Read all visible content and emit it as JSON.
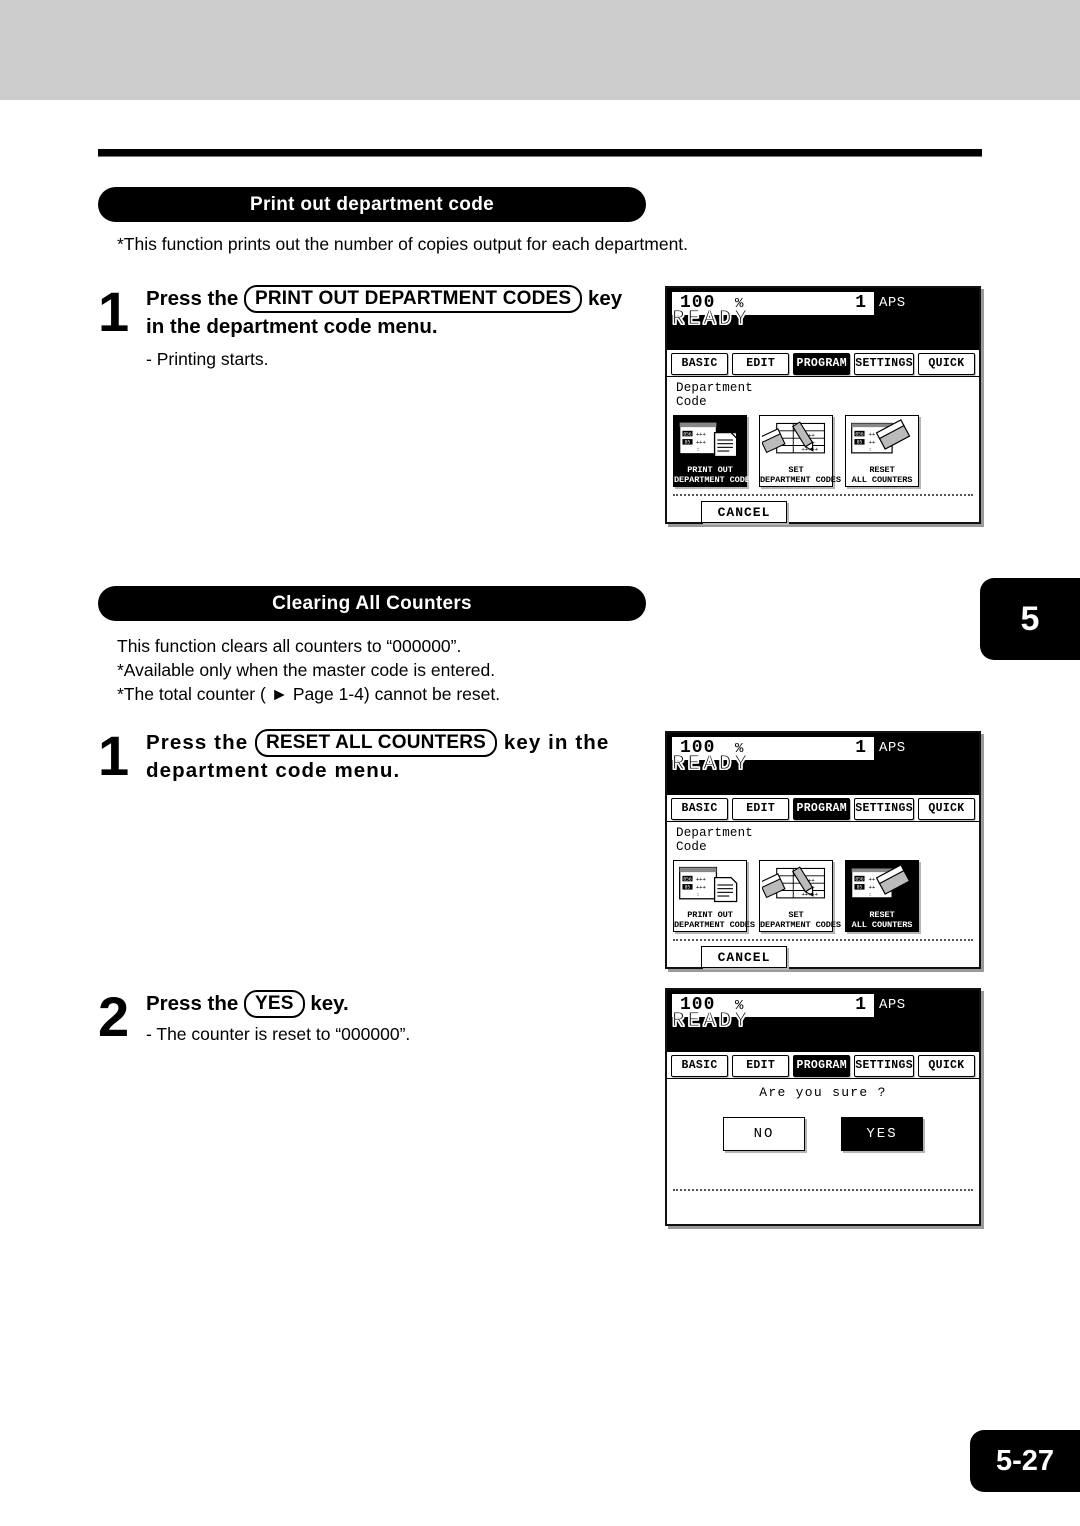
{
  "page": {
    "chapter_tab": "5",
    "page_number": "5-27"
  },
  "sections": [
    {
      "id": "print-out-department-code",
      "heading": "Print out department code",
      "notes": [
        "*This function prints out the number of copies output for each department."
      ],
      "steps": [
        {
          "number": "1",
          "lead": "Press the",
          "keycap": "PRINT OUT DEPARTMENT CODES",
          "tail": "key",
          "line2": "in the department code menu.",
          "sub": "- Printing starts."
        }
      ]
    },
    {
      "id": "clearing-all-counters",
      "heading": "Clearing All Counters",
      "notes": [
        "This function clears all counters to “000000”.",
        "*Available only when the master code is entered.",
        "*The total counter ( ► Page 1-4) cannot be reset."
      ],
      "steps": [
        {
          "number": "1",
          "lead": "Press the",
          "keycap": "RESET ALL COUNTERS",
          "tail": "key in the",
          "line2": "department code menu.",
          "sub": ""
        },
        {
          "number": "2",
          "lead": "Press the",
          "keycap": "YES",
          "tail": "key.",
          "line2": "",
          "sub": "- The counter is reset to “000000”."
        }
      ]
    }
  ],
  "lcd_common": {
    "zoom_ratio": "100",
    "percent_symbol": "%",
    "copies": "1",
    "paper_mode": "APS",
    "status": "READY",
    "tabs": [
      {
        "label": "BASIC",
        "active": false
      },
      {
        "label": "EDIT",
        "active": false
      },
      {
        "label": "PROGRAM",
        "active": true
      },
      {
        "label": "SETTINGS",
        "active": false
      },
      {
        "label": "QUICK",
        "active": false
      }
    ],
    "menu_title": "Department\nCode",
    "cancel_label": "CANCEL",
    "icons": [
      {
        "name": "print-out-department-codes",
        "caption": "PRINT OUT\nDEPARTMENT CODES"
      },
      {
        "name": "set-department-codes",
        "caption": "SET\nDEPARTMENT CODES"
      },
      {
        "name": "reset-all-counters",
        "caption": "RESET\nALL COUNTERS"
      }
    ]
  },
  "screens": [
    {
      "id": "screen-print-out",
      "selected_icon": 0
    },
    {
      "id": "screen-reset-all",
      "selected_icon": 2
    },
    {
      "id": "screen-confirm",
      "question": "Are you sure ?",
      "buttons": [
        {
          "label": "NO",
          "selected": false
        },
        {
          "label": "YES",
          "selected": true
        }
      ]
    }
  ],
  "colors": {
    "ink": "#000000",
    "paper": "#ffffff",
    "top_band": "#cccccc",
    "lcd_shadow": "#9a9a9a"
  }
}
